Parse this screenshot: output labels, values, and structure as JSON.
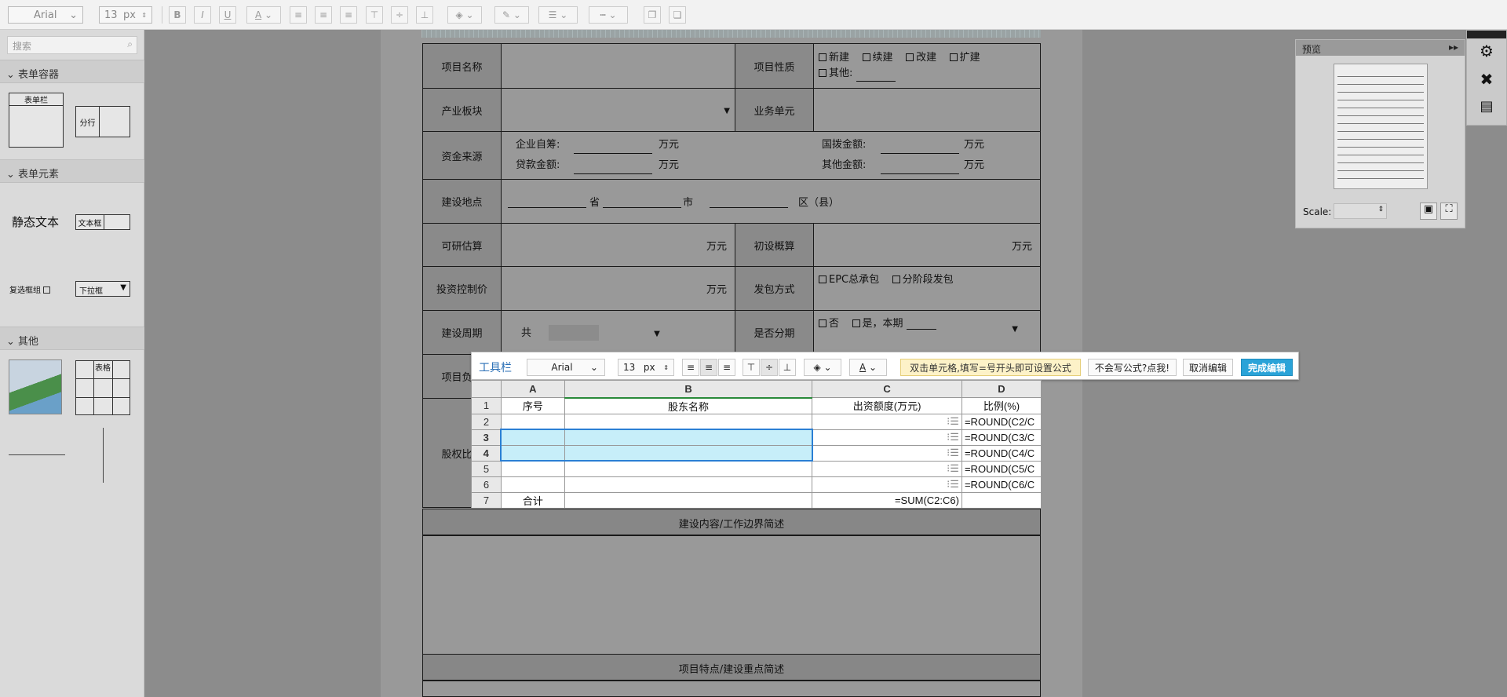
{
  "toolbar": {
    "font_family": "Arial",
    "font_size": "13",
    "font_unit": "px",
    "bold": "B",
    "italic": "I",
    "underline": "U",
    "font_color": "A"
  },
  "sidebar": {
    "search_placeholder": "搜索",
    "section_containers": "表单容器",
    "container_formbar": "表单栏",
    "container_split": "分行",
    "section_elements": "表单元素",
    "static_text": "静态文本",
    "textbox": "文本框",
    "checkbox_group": "复选框组",
    "dropdown": "下拉框",
    "section_other": "其他",
    "table": "表格"
  },
  "form": {
    "project_name": "项目名称",
    "project_nature": "项目性质",
    "nature_new": "新建",
    "nature_continue": "续建",
    "nature_rebuild": "改建",
    "nature_expand": "扩建",
    "nature_other": "其他:",
    "industry": "产业板块",
    "business_unit": "业务单元",
    "fund_source": "资金来源",
    "self_raised": "企业自筹:",
    "loan": "贷款金额:",
    "state_alloc": "国拨金额:",
    "other_amount": "其他金额:",
    "unit_wan": "万元",
    "site": "建设地点",
    "province": "省",
    "city": "市",
    "district": "区（县）",
    "feasibility": "可研估算",
    "prelim": "初设概算",
    "invest_ctrl": "投资控制价",
    "contract_mode": "发包方式",
    "epc": "EPC总承包",
    "phased_contract": "分阶段发包",
    "period": "建设周期",
    "total": "共",
    "is_phased": "是否分期",
    "no": "否",
    "yes_phase": "是，本期",
    "leader": "项目负责",
    "equity": "股权比例",
    "scope_title": "建设内容/工作边界简述",
    "features_title": "项目特点/建设重点简述"
  },
  "editor": {
    "label": "工具栏",
    "font_family": "Arial",
    "font_size": "13",
    "font_unit": "px",
    "hint": "双击单元格,填写=号开头即可设置公式",
    "formula_help": "不会写公式?点我!",
    "cancel": "取消编辑",
    "done": "完成编辑"
  },
  "sheet": {
    "columns": [
      "A",
      "B",
      "C",
      "D"
    ],
    "rows": [
      {
        "num": "1",
        "a": "序号",
        "b": "股东名称",
        "c": "出资额度(万元)",
        "d": "比例(%)"
      },
      {
        "num": "2",
        "a": "",
        "b": "",
        "c": "",
        "d": "=ROUND(C2/C"
      },
      {
        "num": "3",
        "a": "",
        "b": "",
        "c": "",
        "d": "=ROUND(C3/C"
      },
      {
        "num": "4",
        "a": "",
        "b": "",
        "c": "",
        "d": "=ROUND(C4/C"
      },
      {
        "num": "5",
        "a": "",
        "b": "",
        "c": "",
        "d": "=ROUND(C5/C"
      },
      {
        "num": "6",
        "a": "",
        "b": "",
        "c": "",
        "d": "=ROUND(C6/C"
      },
      {
        "num": "7",
        "a": "合计",
        "b": "",
        "c": "=SUM(C2:C6)",
        "d": ""
      }
    ]
  },
  "preview": {
    "title": "预览",
    "scale_label": "Scale:"
  }
}
